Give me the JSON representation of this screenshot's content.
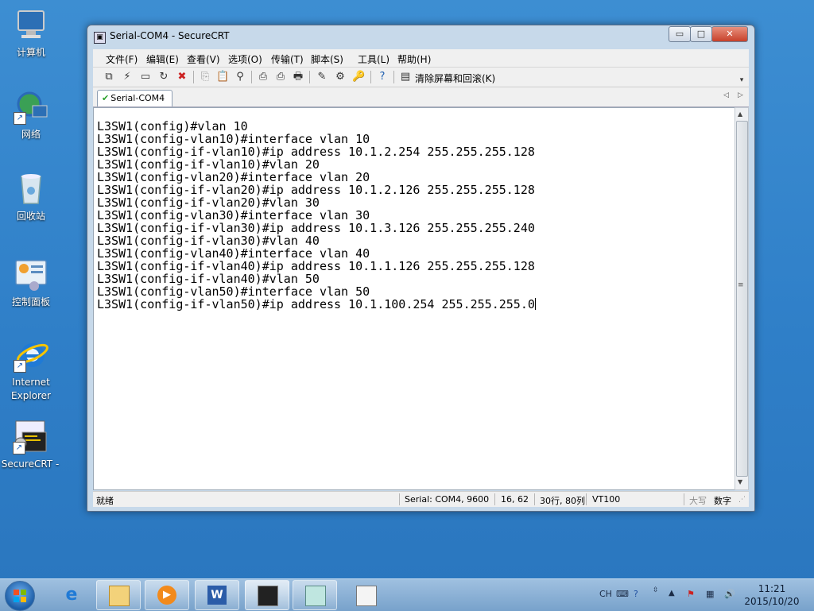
{
  "desktop": {
    "icons": [
      {
        "label": "计算机",
        "icon": "computer-icon"
      },
      {
        "label": "网络",
        "icon": "network-icon"
      },
      {
        "label": "回收站",
        "icon": "recycle-bin-icon"
      },
      {
        "label": "控制面板",
        "icon": "control-panel-icon"
      },
      {
        "label_line1": "Internet",
        "label_line2": "Explorer",
        "icon": "internet-explorer-icon"
      },
      {
        "label": "SecureCRT -",
        "icon": "securecrt-icon"
      }
    ]
  },
  "window": {
    "title": "Serial-COM4 - SecureCRT",
    "controls": {
      "minimize": "▭",
      "maximize": "□",
      "close": "✕"
    },
    "menu": [
      "文件(F)",
      "编辑(E)",
      "查看(V)",
      "选项(O)",
      "传输(T)",
      "脚本(S)",
      "工具(L)",
      "帮助(H)"
    ],
    "toolbar": {
      "clear_screen_label": "清除屏幕和回滚(K)"
    },
    "tab": {
      "label": "Serial-COM4",
      "status": "connected"
    },
    "terminal_lines": [
      "L3SW1(config)#vlan 10",
      "L3SW1(config-vlan10)#interface vlan 10",
      "L3SW1(config-if-vlan10)#ip address 10.1.2.254 255.255.255.128",
      "L3SW1(config-if-vlan10)#vlan 20",
      "L3SW1(config-vlan20)#interface vlan 20",
      "L3SW1(config-if-vlan20)#ip address 10.1.2.126 255.255.255.128",
      "L3SW1(config-if-vlan20)#vlan 30",
      "L3SW1(config-vlan30)#interface vlan 30",
      "L3SW1(config-if-vlan30)#ip address 10.1.3.126 255.255.255.240",
      "L3SW1(config-if-vlan30)#vlan 40",
      "L3SW1(config-vlan40)#interface vlan 40",
      "L3SW1(config-if-vlan40)#ip address 10.1.1.126 255.255.255.128",
      "L3SW1(config-if-vlan40)#vlan 50",
      "L3SW1(config-vlan50)#interface vlan 50",
      "L3SW1(config-if-vlan50)#ip address 10.1.100.254 255.255.255.0"
    ],
    "status": {
      "ready": "就绪",
      "session": "Serial: COM4, 9600",
      "cursor_pos": "16, 62",
      "size": "30行, 80列",
      "emulation": "VT100",
      "caps": "大写",
      "num": "数字"
    }
  },
  "taskbar": {
    "apps": [
      "internet-explorer-icon",
      "file-explorer-icon",
      "media-player-icon",
      "word-icon",
      "securecrt-icon",
      "notepad-icon",
      "document-icon"
    ],
    "tray": {
      "lang": "CH"
    },
    "clock": {
      "time": "11:21",
      "date": "2015/10/20"
    }
  }
}
